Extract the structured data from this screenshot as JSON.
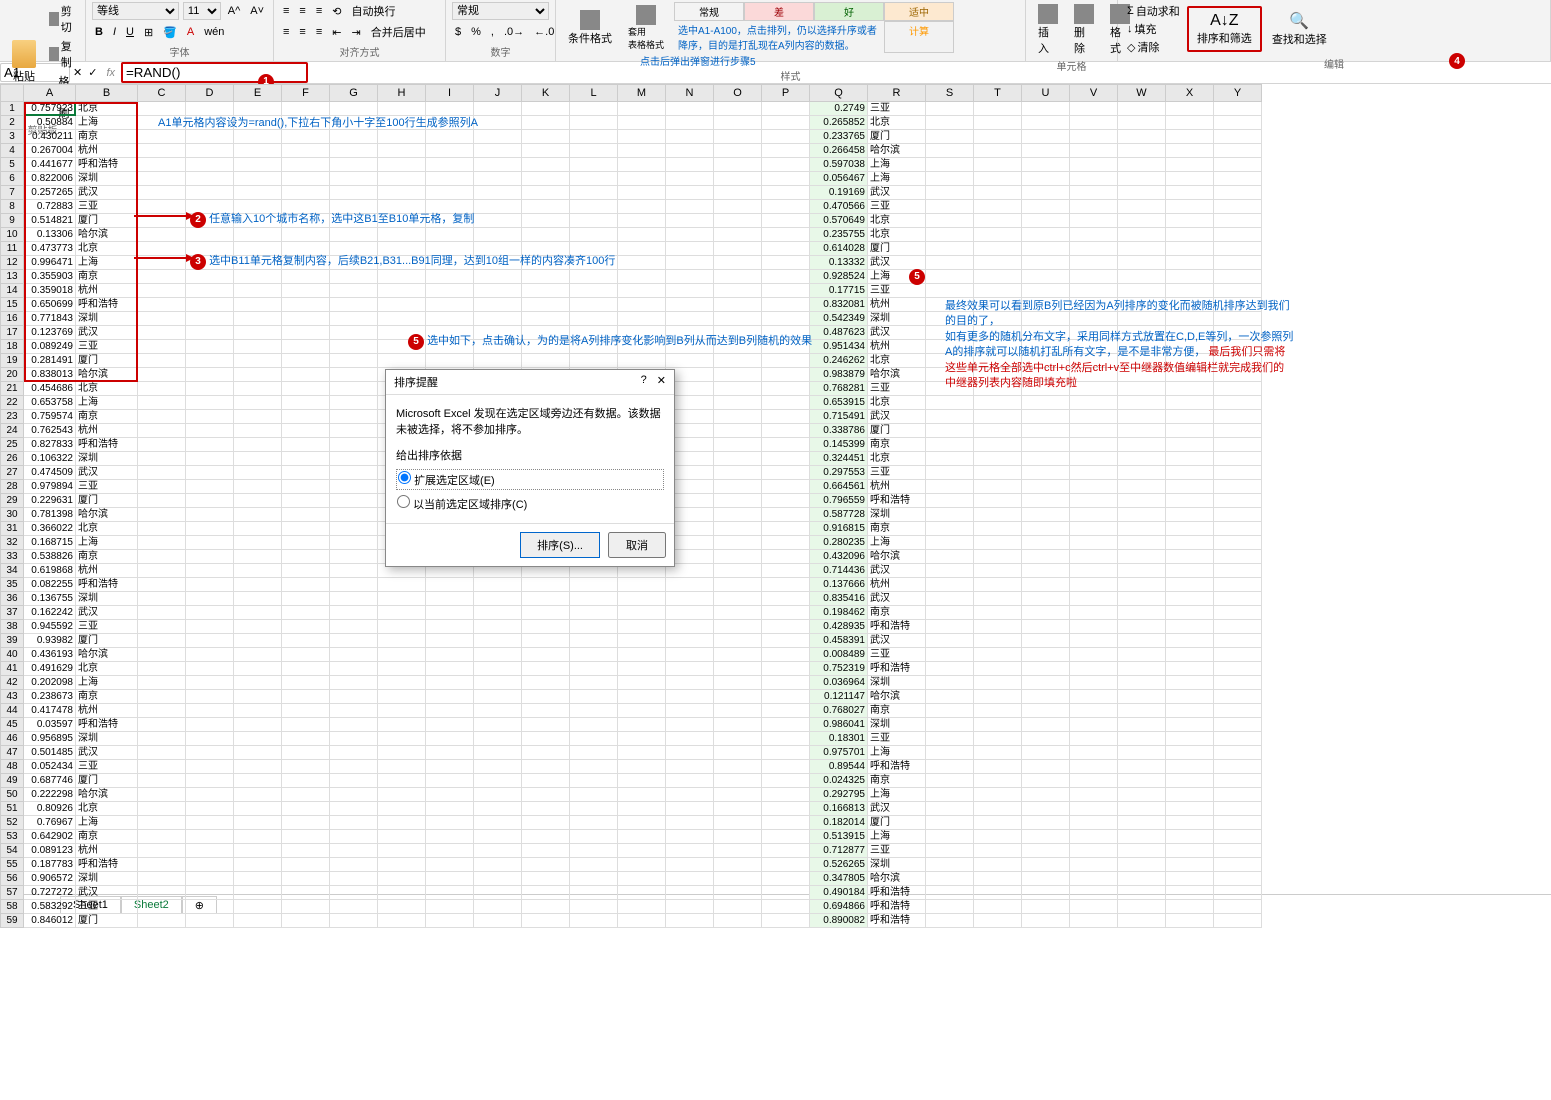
{
  "ribbon": {
    "clipboard": {
      "paste": "粘贴",
      "cut": "剪切",
      "copy": "复制",
      "painter": "格式刷",
      "label": "剪贴板"
    },
    "font": {
      "name": "等线",
      "size": "11",
      "label": "字体"
    },
    "align": {
      "wrap": "自动换行",
      "merge": "合并后居中",
      "label": "对齐方式"
    },
    "number": {
      "format": "常规",
      "label": "数字"
    },
    "styles": {
      "cond": "条件格式",
      "table": "套用\n表格格式",
      "normal": "常规",
      "bad": "差",
      "good": "好",
      "neutral": "适中",
      "calc": "计算",
      "label": "样式"
    },
    "cells": {
      "insert": "插入",
      "delete": "删除",
      "format": "格式",
      "label": "单元格"
    },
    "editing": {
      "autosum": "自动求和",
      "fill": "填充",
      "clear": "清除",
      "sort": "排序和筛选",
      "find": "查找和选择",
      "label": "编辑"
    }
  },
  "namebox": "A1",
  "formula": "=RAND()",
  "columns": [
    "A",
    "B",
    "C",
    "D",
    "E",
    "F",
    "G",
    "H",
    "I",
    "J",
    "K",
    "L",
    "M",
    "N",
    "O",
    "P",
    "Q",
    "R",
    "S",
    "T",
    "U",
    "V",
    "W",
    "X",
    "Y"
  ],
  "left_data": [
    [
      "0.757923",
      "北京"
    ],
    [
      "0.50884",
      "上海"
    ],
    [
      "0.430211",
      "南京"
    ],
    [
      "0.267004",
      "杭州"
    ],
    [
      "0.441677",
      "呼和浩特"
    ],
    [
      "0.822006",
      "深圳"
    ],
    [
      "0.257265",
      "武汉"
    ],
    [
      "0.72883",
      "三亚"
    ],
    [
      "0.514821",
      "厦门"
    ],
    [
      "0.13306",
      "哈尔滨"
    ],
    [
      "0.473773",
      "北京"
    ],
    [
      "0.996471",
      "上海"
    ],
    [
      "0.355903",
      "南京"
    ],
    [
      "0.359018",
      "杭州"
    ],
    [
      "0.650699",
      "呼和浩特"
    ],
    [
      "0.771843",
      "深圳"
    ],
    [
      "0.123769",
      "武汉"
    ],
    [
      "0.089249",
      "三亚"
    ],
    [
      "0.281491",
      "厦门"
    ],
    [
      "0.838013",
      "哈尔滨"
    ],
    [
      "0.454686",
      "北京"
    ],
    [
      "0.653758",
      "上海"
    ],
    [
      "0.759574",
      "南京"
    ],
    [
      "0.762543",
      "杭州"
    ],
    [
      "0.827833",
      "呼和浩特"
    ],
    [
      "0.106322",
      "深圳"
    ],
    [
      "0.474509",
      "武汉"
    ],
    [
      "0.979894",
      "三亚"
    ],
    [
      "0.229631",
      "厦门"
    ],
    [
      "0.781398",
      "哈尔滨"
    ],
    [
      "0.366022",
      "北京"
    ],
    [
      "0.168715",
      "上海"
    ],
    [
      "0.538826",
      "南京"
    ],
    [
      "0.619868",
      "杭州"
    ],
    [
      "0.082255",
      "呼和浩特"
    ],
    [
      "0.136755",
      "深圳"
    ],
    [
      "0.162242",
      "武汉"
    ],
    [
      "0.945592",
      "三亚"
    ],
    [
      "0.93982",
      "厦门"
    ],
    [
      "0.436193",
      "哈尔滨"
    ],
    [
      "0.491629",
      "北京"
    ],
    [
      "0.202098",
      "上海"
    ],
    [
      "0.238673",
      "南京"
    ],
    [
      "0.417478",
      "杭州"
    ],
    [
      "0.03597",
      "呼和浩特"
    ],
    [
      "0.956895",
      "深圳"
    ],
    [
      "0.501485",
      "武汉"
    ],
    [
      "0.052434",
      "三亚"
    ],
    [
      "0.687746",
      "厦门"
    ],
    [
      "0.222298",
      "哈尔滨"
    ],
    [
      "0.80926",
      "北京"
    ],
    [
      "0.76967",
      "上海"
    ],
    [
      "0.642902",
      "南京"
    ],
    [
      "0.089123",
      "杭州"
    ],
    [
      "0.187783",
      "呼和浩特"
    ],
    [
      "0.906572",
      "深圳"
    ],
    [
      "0.727272",
      "武汉"
    ],
    [
      "0.583292",
      "三亚"
    ],
    [
      "0.846012",
      "厦门"
    ]
  ],
  "right_data": [
    [
      "0.2749",
      "三亚"
    ],
    [
      "0.265852",
      "北京"
    ],
    [
      "0.233765",
      "厦门"
    ],
    [
      "0.266458",
      "哈尔滨"
    ],
    [
      "0.597038",
      "上海"
    ],
    [
      "0.056467",
      "上海"
    ],
    [
      "0.19169",
      "武汉"
    ],
    [
      "0.470566",
      "三亚"
    ],
    [
      "0.570649",
      "北京"
    ],
    [
      "0.235755",
      "北京"
    ],
    [
      "0.614028",
      "厦门"
    ],
    [
      "0.13332",
      "武汉"
    ],
    [
      "0.928524",
      "上海"
    ],
    [
      "0.17715",
      "三亚"
    ],
    [
      "0.832081",
      "杭州"
    ],
    [
      "0.542349",
      "深圳"
    ],
    [
      "0.487623",
      "武汉"
    ],
    [
      "0.951434",
      "杭州"
    ],
    [
      "0.246262",
      "北京"
    ],
    [
      "0.983879",
      "哈尔滨"
    ],
    [
      "0.768281",
      "三亚"
    ],
    [
      "0.653915",
      "北京"
    ],
    [
      "0.715491",
      "武汉"
    ],
    [
      "0.338786",
      "厦门"
    ],
    [
      "0.145399",
      "南京"
    ],
    [
      "0.324451",
      "北京"
    ],
    [
      "0.297553",
      "三亚"
    ],
    [
      "0.664561",
      "杭州"
    ],
    [
      "0.796559",
      "呼和浩特"
    ],
    [
      "0.587728",
      "深圳"
    ],
    [
      "0.916815",
      "南京"
    ],
    [
      "0.280235",
      "上海"
    ],
    [
      "0.432096",
      "哈尔滨"
    ],
    [
      "0.714436",
      "武汉"
    ],
    [
      "0.137666",
      "杭州"
    ],
    [
      "0.835416",
      "武汉"
    ],
    [
      "0.198462",
      "南京"
    ],
    [
      "0.428935",
      "呼和浩特"
    ],
    [
      "0.458391",
      "武汉"
    ],
    [
      "0.008489",
      "三亚"
    ],
    [
      "0.752319",
      "呼和浩特"
    ],
    [
      "0.036964",
      "深圳"
    ],
    [
      "0.121147",
      "哈尔滨"
    ],
    [
      "0.768027",
      "南京"
    ],
    [
      "0.986041",
      "深圳"
    ],
    [
      "0.18301",
      "三亚"
    ],
    [
      "0.975701",
      "上海"
    ],
    [
      "0.89544",
      "呼和浩特"
    ],
    [
      "0.024325",
      "南京"
    ],
    [
      "0.292795",
      "上海"
    ],
    [
      "0.166813",
      "武汉"
    ],
    [
      "0.182014",
      "厦门"
    ],
    [
      "0.513915",
      "上海"
    ],
    [
      "0.712877",
      "三亚"
    ],
    [
      "0.526265",
      "深圳"
    ],
    [
      "0.347805",
      "哈尔滨"
    ],
    [
      "0.490184",
      "呼和浩特"
    ],
    [
      "0.694866",
      "呼和浩特"
    ],
    [
      "0.890082",
      "呼和浩特"
    ]
  ],
  "annotations": {
    "a1": "A1单元格内容设为=rand(),下拉右下角小十字至100行生成参照列A",
    "a2": "任意输入10个城市名称，选中这B1至B10单元格，复制",
    "a3": "选中B11单元格复制内容，后续B21,B31...B91同理，达到10组一样的内容凑齐100行",
    "a5": "选中如下，点击确认，为的是将A列排序变化影响到B列从而达到B列随机的效果",
    "ribbon_note1": "选中A1-A100，点击排列，仍以选择升序或者降序，目的是打乱现在A列内容的数据。",
    "ribbon_note2": "点击后弹出弹窗进行步骤5",
    "right1": "最终效果可以看到原B列已经因为A列排序的变化而被随机排序达到我们的目的了，",
    "right2": "如有更多的随机分布文字，采用同样方式放置在C,D,E等列，一次参照列A的排序就可以随机打乱所有文字，是不是非常方便，",
    "right3": "最后我们只需将这些单元格全部选中ctrl+c然后ctrl+v至中继器数值编辑栏就完成我们的中继器列表内容随即填充啦"
  },
  "dialog": {
    "title": "排序提醒",
    "msg": "Microsoft Excel 发现在选定区域旁边还有数据。该数据未被选择，将不参加排序。",
    "groupLabel": "给出排序依据",
    "opt1": "扩展选定区域(E)",
    "opt2": "以当前选定区域排序(C)",
    "ok": "排序(S)...",
    "cancel": "取消"
  },
  "tabs": {
    "s1": "Sheet1",
    "s2": "Sheet2"
  }
}
